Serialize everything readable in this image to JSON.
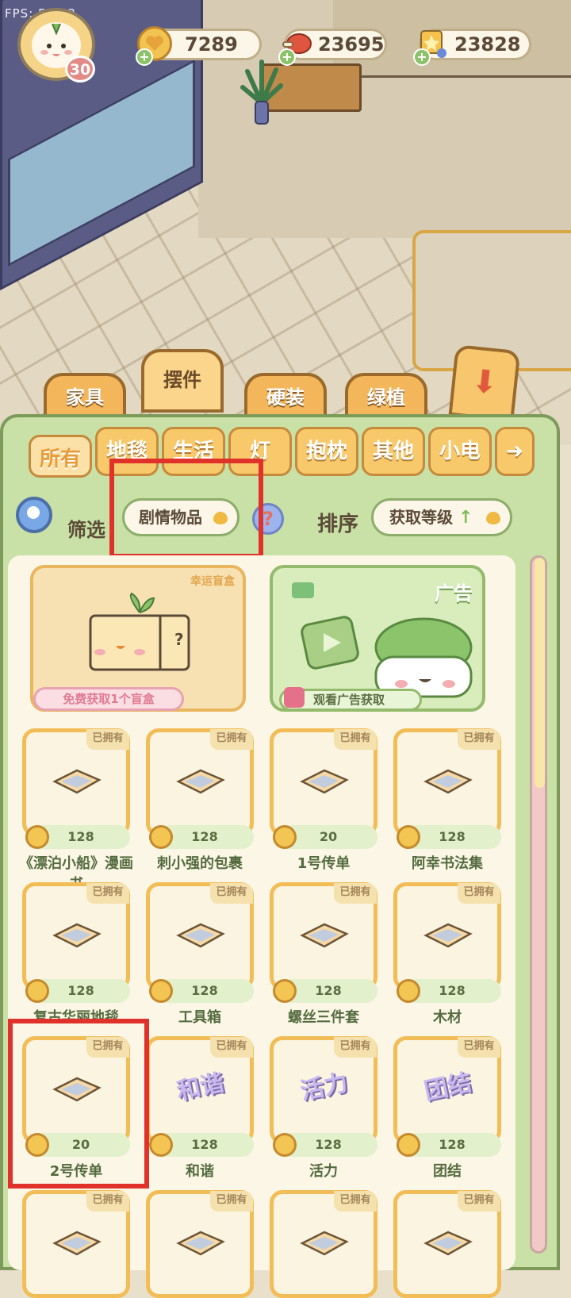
{
  "hud": {
    "fps_label": "FPS: 58.33",
    "level": "30",
    "coins": "7289",
    "meat": "23695",
    "stars": "23828",
    "add_symbol": "+"
  },
  "category_tabs": [
    {
      "label": "家具",
      "active": false
    },
    {
      "label": "摆件",
      "active": true
    },
    {
      "label": "硬装",
      "active": false
    },
    {
      "label": "绿植",
      "active": false
    }
  ],
  "sub_tabs": [
    {
      "label": "所有",
      "active": true
    },
    {
      "label": "地毯",
      "active": false
    },
    {
      "label": "生活",
      "active": false
    },
    {
      "label": "灯",
      "active": false
    },
    {
      "label": "抱枕",
      "active": false
    },
    {
      "label": "其他",
      "active": false
    },
    {
      "label": "小电",
      "active": false
    }
  ],
  "filter": {
    "label": "筛选",
    "value": "剧情物品",
    "help_symbol": "?",
    "sort_label": "排序",
    "sort_value": "获取等级",
    "sort_arrow": "↑"
  },
  "promos": {
    "blind_box_tag": "幸运盲盒",
    "blind_box_mark": "?",
    "blind_box_button": "免费获取1个盲盒",
    "ad_tag": "广告",
    "ad_button": "观看广告获取"
  },
  "owned_label": "已拥有",
  "items": [
    {
      "name": "《漂泊小船》漫画书",
      "price": "128",
      "icon": "comic-book-icon"
    },
    {
      "name": "刺小强的包裹",
      "price": "128",
      "icon": "parcel-icon"
    },
    {
      "name": "1号传单",
      "price": "20",
      "icon": "flyer-icon"
    },
    {
      "name": "阿幸书法集",
      "price": "128",
      "icon": "calligraphy-book-icon"
    },
    {
      "name": "复古华丽地毯",
      "price": "128",
      "icon": "rug-icon"
    },
    {
      "name": "工具箱",
      "price": "128",
      "icon": "toolbox-icon"
    },
    {
      "name": "螺丝三件套",
      "price": "128",
      "icon": "screws-icon"
    },
    {
      "name": "木材",
      "price": "128",
      "icon": "lumber-icon"
    },
    {
      "name": "2号传单",
      "price": "20",
      "icon": "flyer-icon"
    },
    {
      "name": "和谐",
      "price": "128",
      "icon": "text-sign-icon",
      "sign": "和谐"
    },
    {
      "name": "活力",
      "price": "128",
      "icon": "text-sign-icon",
      "sign": "活力"
    },
    {
      "name": "团结",
      "price": "128",
      "icon": "text-sign-icon",
      "sign": "团结"
    },
    {
      "name": "",
      "price": "",
      "icon": "item-icon"
    },
    {
      "name": "",
      "price": "",
      "icon": "item-icon"
    },
    {
      "name": "",
      "price": "",
      "icon": "item-icon"
    },
    {
      "name": "",
      "price": "",
      "icon": "item-icon"
    }
  ],
  "colors": {
    "highlight": "#e0312b",
    "panel": "#c9e0a6",
    "accent_orange": "#f3b65b"
  }
}
